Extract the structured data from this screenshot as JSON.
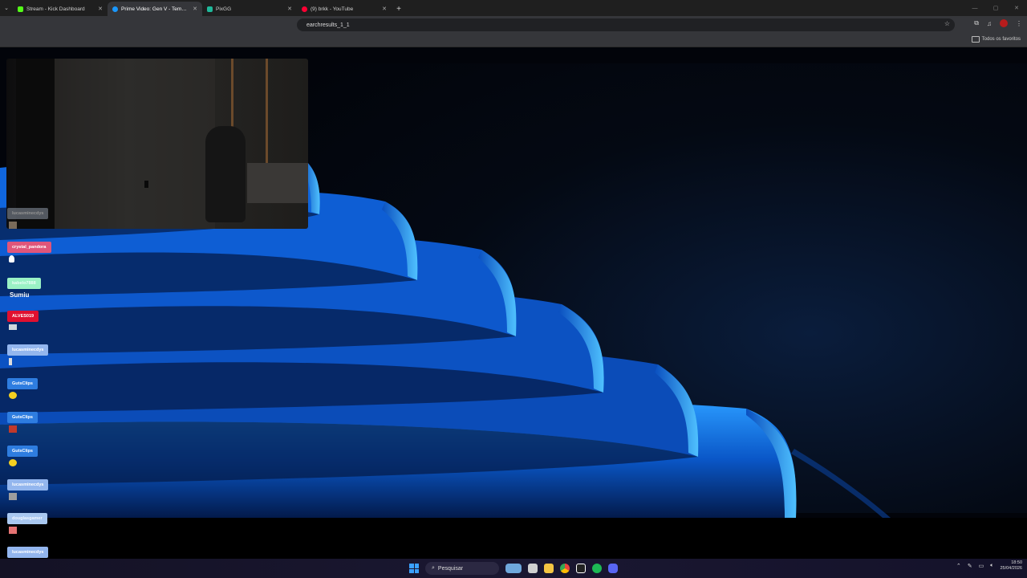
{
  "browser": {
    "tabs": [
      {
        "title": "Stream - Kick Dashboard",
        "favicon_color": "#53fc18",
        "active": false
      },
      {
        "title": "Prime Video: Gen V - Tempora…",
        "favicon_color": "#1a98ff",
        "active": true
      },
      {
        "title": "PixGG",
        "favicon_color": "#1fb89a",
        "active": false
      },
      {
        "title": "(9) brkk - YouTube",
        "favicon_color": "#ff0033",
        "active": false
      }
    ],
    "new_tab_label": "+",
    "address_text": "earchresults_1_1",
    "bookmarks_label": "Todos os favoritos"
  },
  "chat": [
    {
      "user": "lucasminecdys",
      "color": "#8f98a6",
      "msg_icon": "avatar-sticker",
      "msg_color": "#7a6b5a"
    },
    {
      "user": "crystal_pandora",
      "color": "#e0557a",
      "msg_icon": "ghost-emote",
      "msg_color": "#ffffff"
    },
    {
      "user": "kabelo7888",
      "color": "#9af2c5",
      "msg_text": "Sumiu"
    },
    {
      "user": "ALVES019",
      "color": "#e01030",
      "msg_icon": "car-emote",
      "msg_color": "#cfd8dc"
    },
    {
      "user": "lucasminecdys",
      "color": "#93b6ee",
      "msg_icon": "sword-emote",
      "msg_color": "#dddddd"
    },
    {
      "user": "GutsClips",
      "color": "#2e7de0",
      "msg_icon": "pokeball-emote",
      "msg_color": "#f5d020"
    },
    {
      "user": "GutsClips",
      "color": "#2e7de0",
      "msg_icon": "chest-emote",
      "msg_color": "#c0392b"
    },
    {
      "user": "GutsClips",
      "color": "#2e7de0",
      "msg_icon": "pokeball-emote",
      "msg_color": "#f5d020"
    },
    {
      "user": "lucasminecdys",
      "color": "#93b6ee",
      "msg_icon": "robot-emote",
      "msg_color": "#9e9e9e"
    },
    {
      "user": "douglasgamer",
      "color": "#a9c8f0",
      "msg_icon": "hand-emote",
      "msg_color": "#e57373"
    },
    {
      "user": "lucasminecdys",
      "color": "#93b6ee",
      "msg_icon": "crown-emote",
      "msg_color": "#f9a825"
    }
  ],
  "taskbar": {
    "search_placeholder": "Pesquisar",
    "time": "18:50",
    "date": "25/04/2026",
    "apps": [
      {
        "name": "widgets",
        "color": "#6fa8dc"
      },
      {
        "name": "task-view",
        "color": "#d0d0d0"
      },
      {
        "name": "file-explorer",
        "color": "#f4c542"
      },
      {
        "name": "chrome",
        "color": "#e8453c"
      },
      {
        "name": "capcut",
        "color": "#ffffff"
      },
      {
        "name": "spotify",
        "color": "#1db954"
      },
      {
        "name": "discord",
        "color": "#5865f2"
      }
    ]
  }
}
